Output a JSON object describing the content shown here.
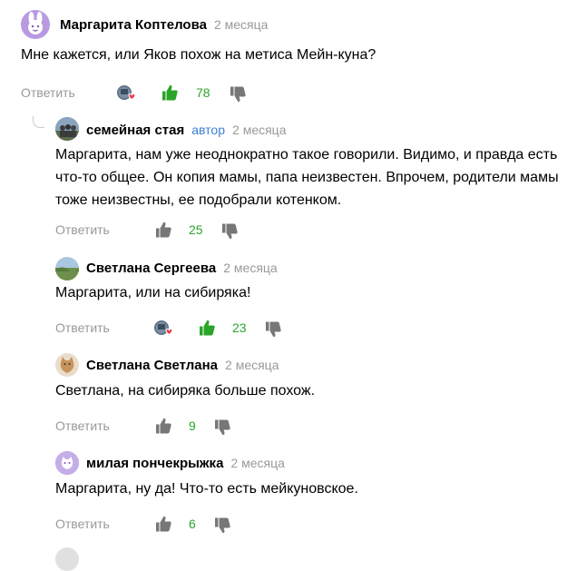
{
  "comments": [
    {
      "author": "Маргарита Коптелова",
      "date": "2 месяца",
      "text": [
        "Мне кажется, или Яков похож на метиса Мейн-куна?"
      ],
      "reply_label": "Ответить",
      "likes": "78",
      "liked": true
    },
    {
      "author": "семейная стая",
      "author_badge": "автор",
      "date": "2 месяца",
      "text": [
        "Маргарита, нам уже неоднократно такое говорили. Видимо, и правда есть",
        "что-то общее. Он копия мамы, папа неизвестен. Впрочем, родители мамы",
        "тоже неизвестны, ее подобрали котенком."
      ],
      "reply_label": "Ответить",
      "likes": "25",
      "liked": false
    },
    {
      "author": "Светлана Сергеева",
      "date": "2 месяца",
      "text": [
        "Маргарита, или на сибиряка!"
      ],
      "reply_label": "Ответить",
      "likes": "23",
      "liked": true
    },
    {
      "author": "Светлана Светлана",
      "date": "2 месяца",
      "text": [
        "Светлана, на сибиряка больше похож."
      ],
      "reply_label": "Ответить",
      "likes": "9",
      "liked": false
    },
    {
      "author": "милая пончекрыжка",
      "date": "2 месяца",
      "text": [
        "Маргарита, ну да! Что-то есть мейкуновское."
      ],
      "reply_label": "Ответить",
      "likes": "6",
      "liked": false
    }
  ],
  "icons": {
    "avatar_1": "purple-bunny-avatar",
    "avatar_2": "family-photo-avatar",
    "avatar_3": "landscape-photo-avatar",
    "avatar_4": "cat-photo-avatar",
    "avatar_5": "purple-cat-avatar",
    "like": "thumbs-up-icon",
    "dislike": "thumbs-down-icon",
    "reactors": "reactor-avatars-heart-icon"
  },
  "colors": {
    "like_active": "#2aa52a",
    "like_inactive": "#777777",
    "count": "#2aa52a",
    "secondary_text": "#999999",
    "author_badge": "#3d7fd6",
    "heart": "#e63b4e"
  }
}
